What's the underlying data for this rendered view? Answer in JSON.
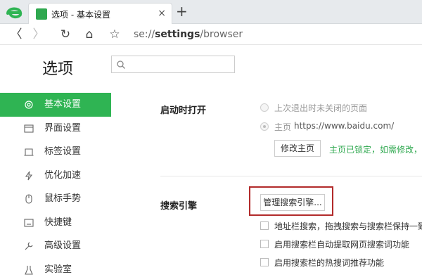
{
  "colors": {
    "accent": "#2fb453",
    "link_green": "#2fa84f",
    "highlight_red": "#b22a2a"
  },
  "tab": {
    "title": "选项 - 基本设置",
    "close_glyph": "×"
  },
  "new_tab_glyph": "+",
  "nav": {
    "back": "〈",
    "forward": "〉",
    "reload": "↻",
    "home": "⌂",
    "bookmark": "☆",
    "address_prefix": "se://",
    "address_main": "settings",
    "address_suffix": "/browser"
  },
  "header": {
    "title": "选项",
    "search_placeholder": ""
  },
  "sidebar": {
    "items": [
      {
        "label": "基本设置",
        "icon": "settings-gear-icon",
        "active": true
      },
      {
        "label": "界面设置",
        "icon": "window-icon"
      },
      {
        "label": "标签设置",
        "icon": "tab-icon"
      },
      {
        "label": "优化加速",
        "icon": "lightning-icon"
      },
      {
        "label": "鼠标手势",
        "icon": "mouse-icon"
      },
      {
        "label": "快捷键",
        "icon": "keyboard-icon"
      },
      {
        "label": "高级设置",
        "icon": "wrench-icon"
      },
      {
        "label": "实验室",
        "icon": "flask-icon"
      }
    ]
  },
  "startup": {
    "label": "启动时打开",
    "option_last": "上次退出时未关闭的页面",
    "option_home_label": "主页",
    "option_home_url": "https://www.baidu.com/",
    "modify_button": "修改主页",
    "locked_note": "主页已锁定，如需修改，请"
  },
  "search_engine": {
    "label": "搜索引擎",
    "manage_button": "管理搜索引擎...",
    "checks": [
      {
        "label": "地址栏搜索，拖拽搜索与搜索栏保持一致"
      },
      {
        "label": "启用搜索栏自动提取网页搜索词功能"
      },
      {
        "label": "启用搜索栏的热搜词推荐功能"
      }
    ]
  }
}
